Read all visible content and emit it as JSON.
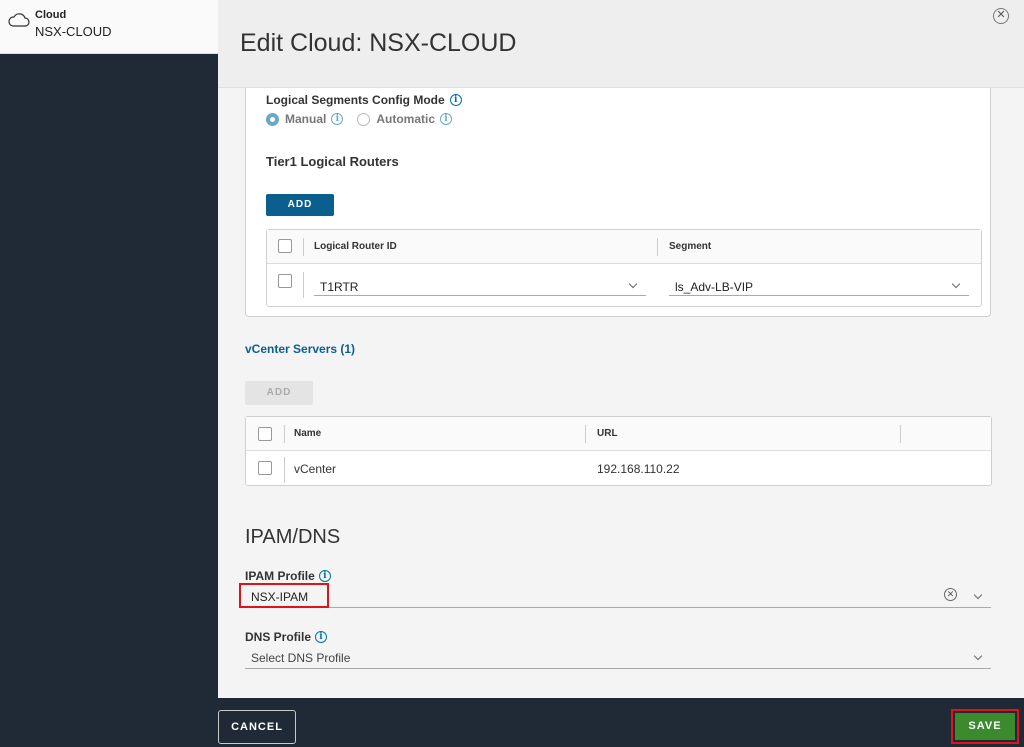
{
  "left_panel": {
    "object_kind": "Cloud",
    "object_name": "NSX-CLOUD"
  },
  "modal": {
    "title": "Edit Cloud: NSX-CLOUD"
  },
  "logical_segments": {
    "label": "Logical Segments Config Mode",
    "options": [
      {
        "label": "Manual",
        "selected": true
      },
      {
        "label": "Automatic",
        "selected": false
      }
    ]
  },
  "tier1": {
    "title": "Tier1 Logical Routers",
    "add_label": "ADD",
    "columns": [
      "Logical Router ID",
      "Segment"
    ],
    "rows": [
      {
        "router": "T1RTR",
        "segment": "ls_Adv-LB-VIP"
      }
    ]
  },
  "vcenter": {
    "title": "vCenter Servers (1)",
    "add_label": "ADD",
    "columns": [
      "Name",
      "URL"
    ],
    "rows": [
      {
        "name": "vCenter",
        "url": "192.168.110.22"
      }
    ]
  },
  "ipam_dns": {
    "title": "IPAM/DNS",
    "ipam_label": "IPAM Profile",
    "ipam_value": "NSX-IPAM",
    "dns_label": "DNS Profile",
    "dns_placeholder": "Select DNS Profile"
  },
  "footer": {
    "cancel_label": "CANCEL",
    "save_label": "SAVE"
  },
  "colors": {
    "primary": "#0b5f8f",
    "save": "#3c8a2e",
    "highlight": "#e0131a",
    "dark": "#1f2a36"
  }
}
